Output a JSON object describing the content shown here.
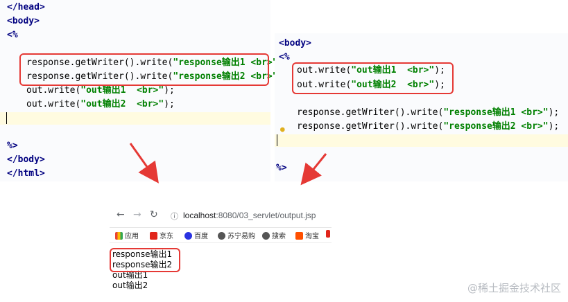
{
  "left_editor": {
    "lines": {
      "head_close": "</head>",
      "body_open": "<body>",
      "scriptlet_open": "<%",
      "resp1_call": "response.getWriter().write(",
      "resp1_str": "\"response输出1 <br>\"",
      "resp2_call": "response.getWriter().write(",
      "resp2_str": "\"response输出2 <br>\"",
      "out1_call": "out.write(",
      "out1_str": "\"out输出1  <br>\"",
      "out1_end": ");",
      "out2_call": "out.write(",
      "out2_str": "\"out输出2  <br>\"",
      "out2_end": ");",
      "scriptlet_close": "%>",
      "body_close": "</body>",
      "html_close": "</html>"
    }
  },
  "right_editor": {
    "lines": {
      "body_open": "<body>",
      "scriptlet_open": "<%",
      "out1_call": "out.write(",
      "out1_str": "\"out输出1  <br>\"",
      "out1_end": ");",
      "out2_call": "out.write(",
      "out2_str": "\"out输出2  <br>\"",
      "out2_end": ");",
      "resp1_call": "response.getWriter().write(",
      "resp1_str": "\"response输出1 <br>\"",
      "resp1_end": ");",
      "resp2_call": "response.getWriter().write(",
      "resp2_str": "\"response输出2 <br>\"",
      "resp2_end": ");",
      "scriptlet_close": "%>"
    }
  },
  "browser": {
    "url_host": "localhost",
    "url_path": ":8080/03_servlet/output.jsp",
    "bookmarks": [
      "应用",
      "京东",
      "百度",
      "苏宁易购",
      "搜索",
      "淘宝"
    ],
    "output": [
      "response输出1",
      "response输出2",
      "out输出1",
      "out输出2"
    ]
  },
  "watermark": "@稀土掘金技术社区",
  "colors": {
    "highlight_box": "#e53935",
    "string": "#008000",
    "keyword": "#000080"
  }
}
